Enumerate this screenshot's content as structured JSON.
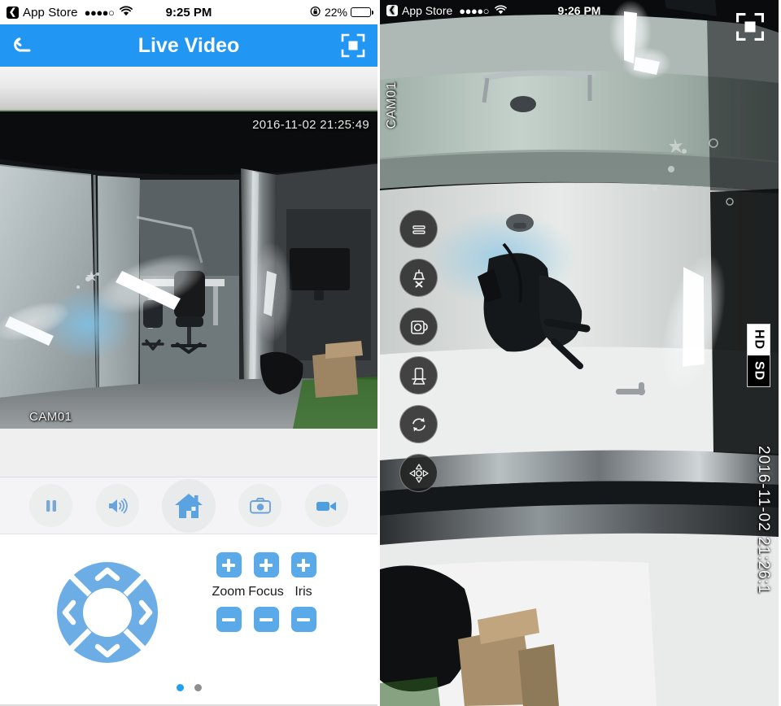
{
  "left_phone": {
    "status_bar": {
      "back_glyph": "‹",
      "carrier_label": "App Store",
      "signal_dots": "●●●●○",
      "wifi_icon": "wifi-icon",
      "time": "9:25 PM",
      "rotation_lock_icon": "rotation-lock-icon",
      "battery_percent": "22%",
      "battery_level": 22
    },
    "nav_bar": {
      "back_icon": "back-arrow-icon",
      "title": "Live Video",
      "fullscreen_icon": "fullscreen-icon"
    },
    "video": {
      "timestamp": "2016-11-02 21:25:49",
      "camera_label": "CAM01"
    },
    "controls": [
      {
        "name": "pause-button",
        "icon": "pause-icon",
        "label": "Pause"
      },
      {
        "name": "audio-button",
        "icon": "speaker-icon",
        "label": "Audio"
      },
      {
        "name": "home-button",
        "icon": "home-icon",
        "label": "Home"
      },
      {
        "name": "snapshot-button",
        "icon": "camera-icon",
        "label": "Snapshot"
      },
      {
        "name": "record-button",
        "icon": "video-camera-icon",
        "label": "Record"
      }
    ],
    "ptz": {
      "dpad_icon": "dpad-icon",
      "up_label": "Up",
      "down_label": "Down",
      "left_label": "Left",
      "right_label": "Right",
      "adjust_groups": [
        {
          "label": "Zoom",
          "plus": "+",
          "minus": "−"
        },
        {
          "label": "Focus",
          "plus": "+",
          "minus": "−"
        },
        {
          "label": "Iris",
          "plus": "+",
          "minus": "−"
        }
      ]
    },
    "pagination": {
      "total": 2,
      "active_index": 0
    }
  },
  "right_phone": {
    "status_bar": {
      "back_glyph": "‹",
      "carrier_label": "App Store",
      "signal_dots": "●●●●○",
      "wifi_icon": "wifi-icon",
      "time": "9:26 PM"
    },
    "fullscreen_icon": "exit-fullscreen-icon",
    "video": {
      "camera_label": "CAM01",
      "timestamp": "2016-11-02 21:26:1"
    },
    "toolbar": [
      {
        "name": "pause-button",
        "icon": "pause-icon",
        "label": "Pause"
      },
      {
        "name": "mute-button",
        "icon": "speaker-mute-icon",
        "label": "Mute"
      },
      {
        "name": "snapshot-button",
        "icon": "camera-icon",
        "label": "Snapshot"
      },
      {
        "name": "record-button",
        "icon": "record-icon",
        "label": "Record"
      },
      {
        "name": "refresh-button",
        "icon": "refresh-icon",
        "label": "Refresh"
      },
      {
        "name": "ptz-button",
        "icon": "dpad-icon",
        "label": "PTZ"
      }
    ],
    "quality": {
      "options": [
        "HD",
        "SD"
      ],
      "selected": "HD"
    }
  },
  "colors": {
    "accent_blue": "#2196f3",
    "button_blue": "#5aa9e8",
    "dot_active": "#22a0f0",
    "dot_inactive": "#8e8e8e"
  }
}
